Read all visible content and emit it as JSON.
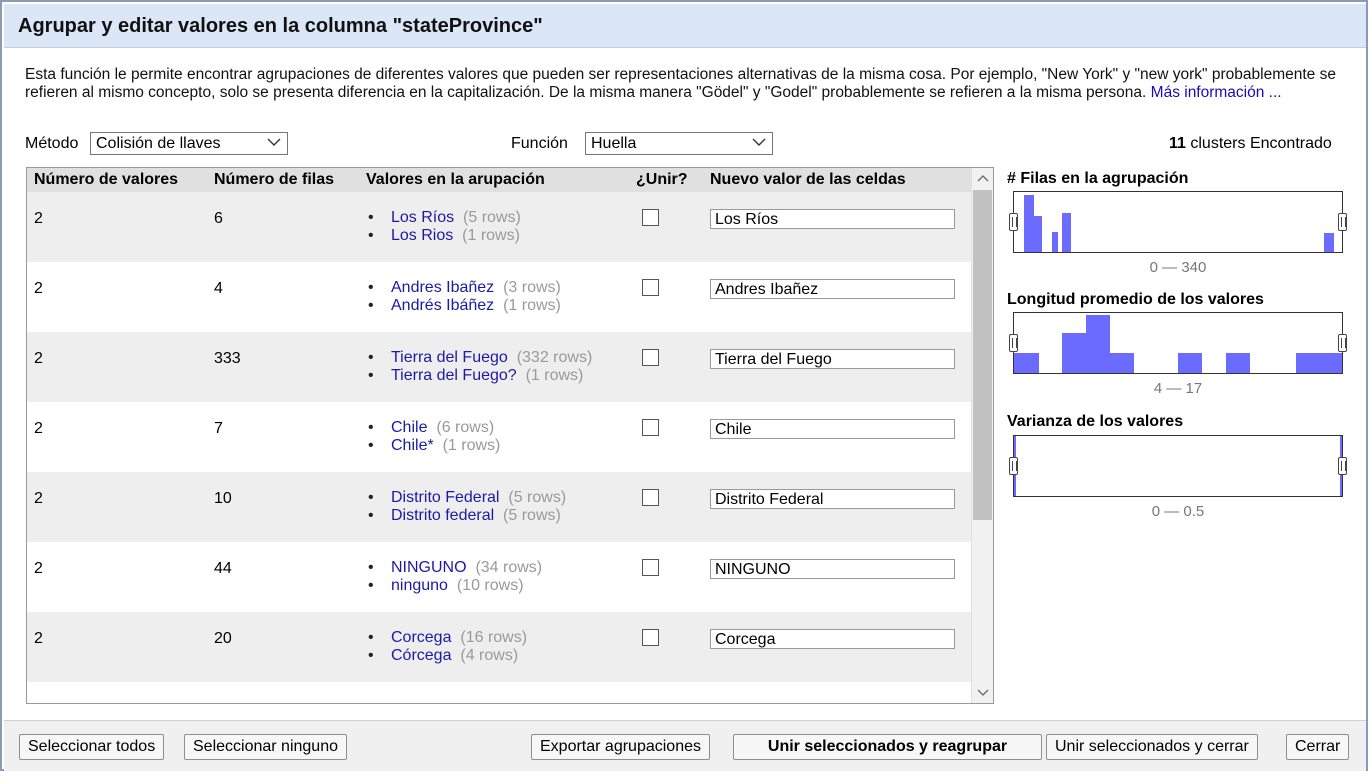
{
  "dialog": {
    "title": "Agrupar y editar valores en la columna \"stateProvince\"",
    "description": "Esta función le permite encontrar agrupaciones de diferentes valores que pueden ser representaciones alternativas de la misma cosa. Por ejemplo, \"New York\" y \"new york\" probablemente se refieren al mismo concepto, solo se presenta diferencia en la capitalización. De la misma manera \"Gödel\" y \"Godel\" probablemente se refieren a la misma persona.",
    "more_info_link": "Más información ..."
  },
  "controls": {
    "method_label": "Método",
    "method_value": "Colisión de llaves",
    "function_label": "Función",
    "function_value": "Huella",
    "clusters_count": "11",
    "clusters_text": "clusters Encontrado"
  },
  "table": {
    "headers": [
      "Número de valores",
      "Número de filas",
      "Valores en la arupación",
      "¿Unir?",
      "Nuevo valor de las celdas"
    ],
    "rows": [
      {
        "num_values": "2",
        "num_rows": "6",
        "values": [
          {
            "name": "Los Ríos",
            "count": "(5 rows)"
          },
          {
            "name": "Los Rios",
            "count": "(1 rows)"
          }
        ],
        "checked": false,
        "new_value": "Los Ríos"
      },
      {
        "num_values": "2",
        "num_rows": "4",
        "values": [
          {
            "name": "Andres Ibañez",
            "count": "(3 rows)"
          },
          {
            "name": "Andrés Ibáñez",
            "count": "(1 rows)"
          }
        ],
        "checked": false,
        "new_value": "Andres Ibañez"
      },
      {
        "num_values": "2",
        "num_rows": "333",
        "values": [
          {
            "name": "Tierra del Fuego",
            "count": "(332 rows)"
          },
          {
            "name": "Tierra del Fuego?",
            "count": "(1 rows)"
          }
        ],
        "checked": false,
        "new_value": "Tierra del Fuego"
      },
      {
        "num_values": "2",
        "num_rows": "7",
        "values": [
          {
            "name": "Chile",
            "count": "(6 rows)"
          },
          {
            "name": "Chile*",
            "count": "(1 rows)"
          }
        ],
        "checked": false,
        "new_value": "Chile"
      },
      {
        "num_values": "2",
        "num_rows": "10",
        "values": [
          {
            "name": "Distrito Federal",
            "count": "(5 rows)"
          },
          {
            "name": "Distrito federal",
            "count": "(5 rows)"
          }
        ],
        "checked": false,
        "new_value": "Distrito Federal"
      },
      {
        "num_values": "2",
        "num_rows": "44",
        "values": [
          {
            "name": "NINGUNO",
            "count": "(34 rows)"
          },
          {
            "name": "ninguno",
            "count": "(10 rows)"
          }
        ],
        "checked": false,
        "new_value": "NINGUNO"
      },
      {
        "num_values": "2",
        "num_rows": "20",
        "values": [
          {
            "name": "Corcega",
            "count": "(16 rows)"
          },
          {
            "name": "Córcega",
            "count": "(4 rows)"
          }
        ],
        "checked": false,
        "new_value": "Corcega"
      }
    ]
  },
  "sidebar": {
    "hist1": {
      "title": "# Filas en la agrupación",
      "range": "0 — 340"
    },
    "hist2": {
      "title": "Longitud promedio de los valores",
      "range": "4 — 17"
    },
    "hist3": {
      "title": "Varianza de los valores",
      "range": "0 — 0.5"
    },
    "bar_color": "#6b6bff"
  },
  "footer": {
    "select_all": "Seleccionar todos",
    "select_none": "Seleccionar ninguno",
    "export": "Exportar agrupaciones",
    "merge_recluster": "Unir seleccionados y reagrupar",
    "merge_close": "Unir seleccionados y cerrar",
    "close": "Cerrar"
  }
}
